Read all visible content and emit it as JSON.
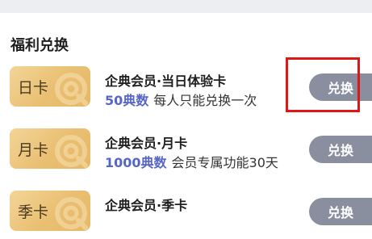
{
  "section_title": "福利兑换",
  "rows": [
    {
      "card_label": "日卡",
      "title": "企典会员·当日体验卡",
      "price": "50典数",
      "description": "每人只能兑换一次",
      "button_label": "兑换"
    },
    {
      "card_label": "月卡",
      "title": "企典会员·月卡",
      "price": "1000典数",
      "description": "会员专属功能30天",
      "button_label": "兑换"
    },
    {
      "card_label": "季卡",
      "title": "企典会员·季卡",
      "price": "",
      "description": "",
      "button_label": "兑换"
    }
  ],
  "colors": {
    "accent_price": "#5565c8",
    "button_bg": "#8a8fa0",
    "card_gold": "#e9bf72",
    "highlight_red": "#e01717"
  },
  "icons": [
    "card-logo-icon"
  ]
}
